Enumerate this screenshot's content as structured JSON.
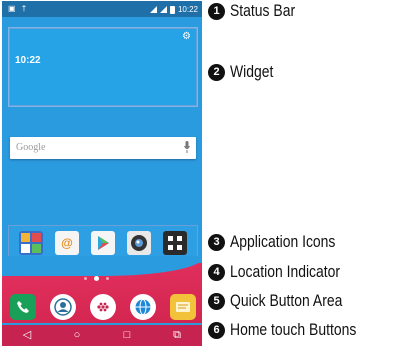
{
  "status_bar": {
    "left_icons": "▣ †",
    "time": "10:22"
  },
  "widget": {
    "time": "10:22",
    "settings_icon": "gear-icon"
  },
  "search": {
    "placeholder": "Google",
    "mic_icon": "mic-icon"
  },
  "apps": [
    {
      "name": "tasks-app-icon",
      "color": "#3a6fc9"
    },
    {
      "name": "email-app-icon",
      "color": "#f5f5f5"
    },
    {
      "name": "play-store-icon",
      "color": "#f5f5f5"
    },
    {
      "name": "camera-app-icon",
      "color": "#e8e8e8"
    },
    {
      "name": "apps-folder-icon",
      "color": "#2a2a2a"
    }
  ],
  "location_indicator": {
    "pages": 3,
    "active": 1
  },
  "quick_buttons": [
    {
      "name": "phone-icon",
      "color": "#18a058"
    },
    {
      "name": "contacts-icon",
      "color": "#ffffff"
    },
    {
      "name": "apps-drawer-icon",
      "color": "#c72350"
    },
    {
      "name": "browser-icon",
      "color": "#ffffff"
    },
    {
      "name": "messaging-icon",
      "color": "#f2c23a"
    }
  ],
  "home_buttons": [
    "◁",
    "○",
    "□",
    "⧉"
  ],
  "annotations": [
    {
      "num": "1",
      "label": "Status Bar"
    },
    {
      "num": "2",
      "label": "Widget"
    },
    {
      "num": "3",
      "label": "Application Icons"
    },
    {
      "num": "4",
      "label": "Location Indicator"
    },
    {
      "num": "5",
      "label": "Quick Button Area"
    },
    {
      "num": "6",
      "label": "Home touch Buttons"
    }
  ]
}
